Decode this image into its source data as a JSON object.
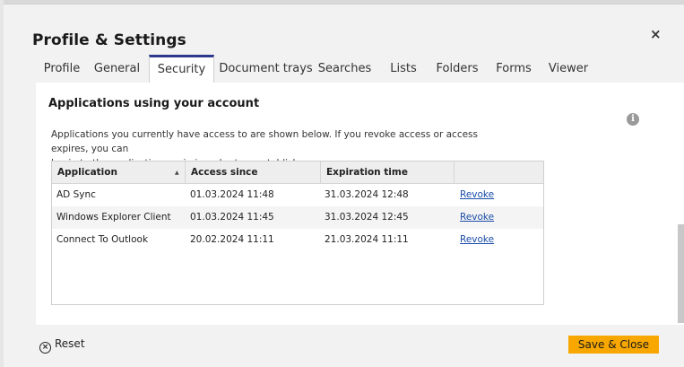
{
  "dialog": {
    "title": "Profile & Settings",
    "close_label": "×"
  },
  "tabs": [
    {
      "label": "Profile",
      "active": false
    },
    {
      "label": "General",
      "active": false
    },
    {
      "label": "Security",
      "active": true
    },
    {
      "label": "Document trays",
      "active": false
    },
    {
      "label": "Searches",
      "active": false
    },
    {
      "label": "Lists",
      "active": false
    },
    {
      "label": "Folders",
      "active": false
    },
    {
      "label": "Forms",
      "active": false
    },
    {
      "label": "Viewer",
      "active": false
    }
  ],
  "section": {
    "title": "Applications using your account",
    "description_line1": "Applications you currently have access to are shown below. If you revoke access or access expires, you can",
    "description_line2": "log in to the application again in order to reestablish access.",
    "info_icon": "i"
  },
  "table": {
    "columns": [
      "Application",
      "Access since",
      "Expiration time"
    ],
    "sort_indicator": "▲",
    "rows": [
      {
        "application": "AD Sync",
        "access_since": "01.03.2024 11:48",
        "expiration": "31.03.2024 12:48",
        "action": "Revoke"
      },
      {
        "application": "Windows Explorer Client",
        "access_since": "01.03.2024 11:45",
        "expiration": "31.03.2024 12:45",
        "action": "Revoke"
      },
      {
        "application": "Connect To Outlook",
        "access_since": "20.02.2024 11:11",
        "expiration": "21.03.2024 11:11",
        "action": "Revoke"
      }
    ]
  },
  "footer": {
    "reset_label": "Reset",
    "reset_icon": "⊗",
    "save_label": "Save & Close"
  },
  "colors": {
    "accent_tab": "#2d3a8c",
    "save_button": "#f7a700",
    "link": "#1a4ca8"
  }
}
